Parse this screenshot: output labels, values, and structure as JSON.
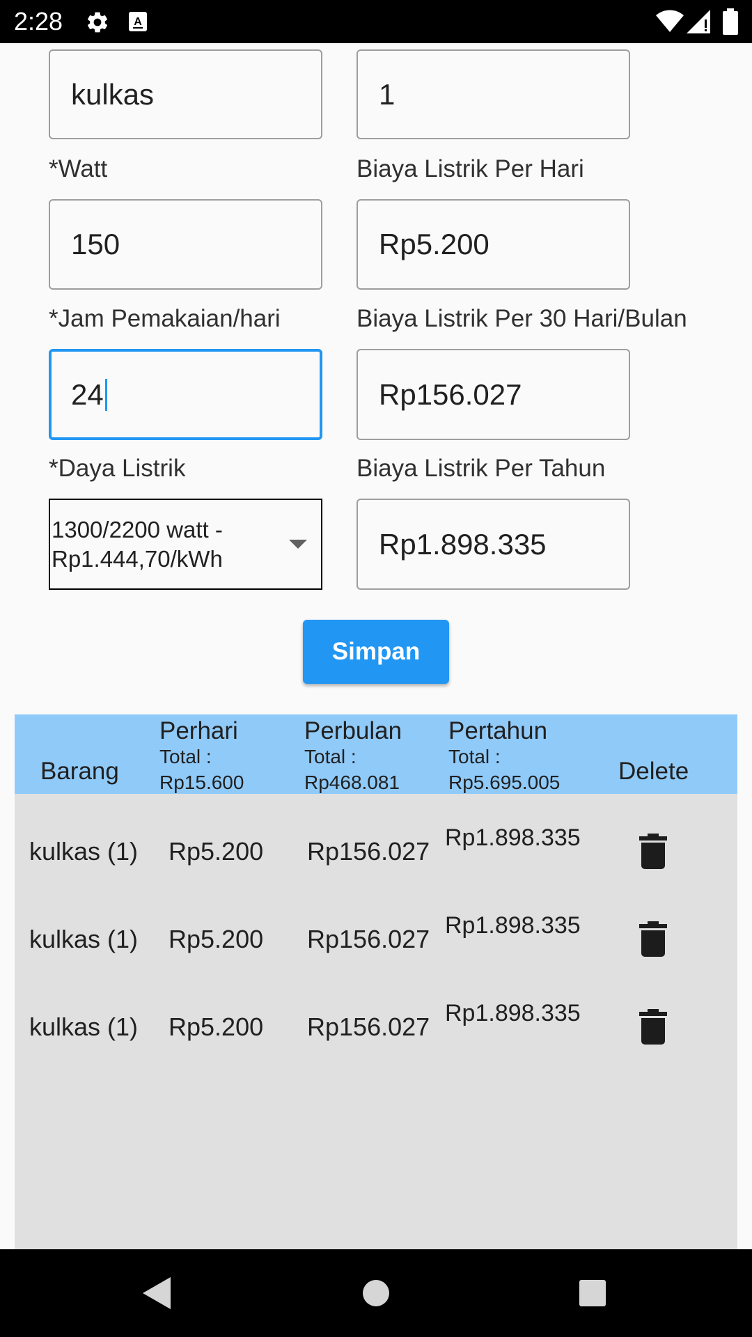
{
  "status_bar": {
    "time": "2:28",
    "icons": [
      "gear-icon",
      "font-a-icon",
      "wifi-icon",
      "signal-icon",
      "battery-icon"
    ]
  },
  "form": {
    "name_value": "kulkas",
    "qty_value": "1",
    "watt_label": "*Watt",
    "watt_value": "150",
    "per_day_label": "Biaya Listrik Per Hari",
    "per_day_value": "Rp5.200",
    "hours_label": "*Jam Pemakaian/hari",
    "hours_value": "24",
    "per_month_label": "Biaya Listrik Per 30 Hari/Bulan",
    "per_month_value": "Rp156.027",
    "power_label": "*Daya Listrik",
    "power_selected": "1300/2200 watt - Rp1.444,70/kWh",
    "per_year_label": "Biaya Listrik Per Tahun",
    "per_year_value": "Rp1.898.335",
    "save_label": "Simpan"
  },
  "table": {
    "headers": {
      "item": "Barang",
      "day": "Perhari",
      "day_total_label": "Total :",
      "day_total": "Rp15.600",
      "month": "Perbulan",
      "month_total_label": "Total :",
      "month_total": "Rp468.081",
      "year": "Pertahun",
      "year_total_label": "Total :",
      "year_total": "Rp5.695.005",
      "delete": "Delete"
    },
    "rows": [
      {
        "item": "kulkas (1)",
        "day": "Rp5.200",
        "month": "Rp156.027",
        "year": "Rp1.898.335"
      },
      {
        "item": "kulkas (1)",
        "day": "Rp5.200",
        "month": "Rp156.027",
        "year": "Rp1.898.335"
      },
      {
        "item": "kulkas (1)",
        "day": "Rp5.200",
        "month": "Rp156.027",
        "year": "Rp1.898.335"
      }
    ]
  },
  "colors": {
    "accent": "#2196f3",
    "table_header": "#90caf9",
    "table_body": "#e0e0e0"
  },
  "nav_bar": {
    "icons": [
      "back-icon",
      "home-icon",
      "recents-icon"
    ]
  }
}
